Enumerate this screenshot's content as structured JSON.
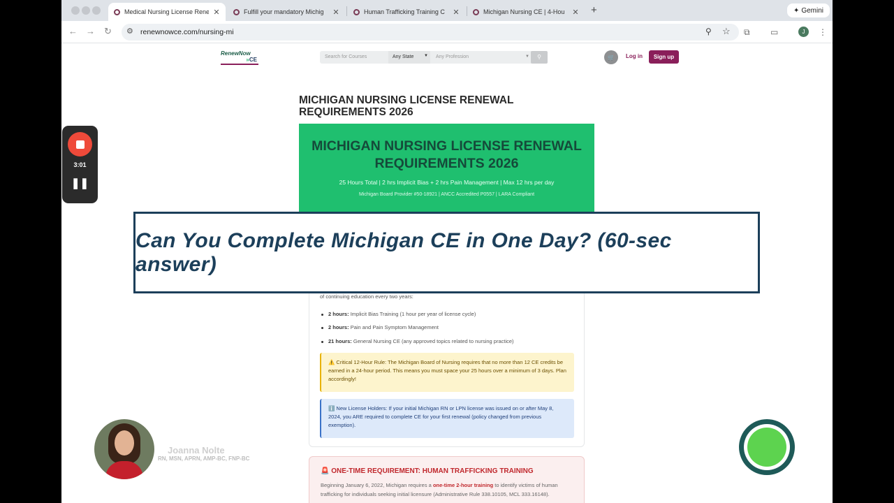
{
  "browser": {
    "tabs": [
      {
        "title": "Medical Nursing License Rene",
        "active": true
      },
      {
        "title": "Fulfill your mandatory Michig",
        "active": false
      },
      {
        "title": "Human Trafficking Training C",
        "active": false
      },
      {
        "title": "Michigan Nursing CE | 4-Hou",
        "active": false
      }
    ],
    "gemini_label": "Gemini",
    "url": "renewnowce.com/nursing-mi",
    "profile_initial": "J"
  },
  "site": {
    "logo_line1": "RenewNow",
    "logo_line2": "CE",
    "search_placeholder": "Search for Courses",
    "state_select": "Any State",
    "profession_placeholder": "Any Profession",
    "login": "Log in",
    "signup": "Sign up"
  },
  "content": {
    "heading": "MICHIGAN NURSING LICENSE RENEWAL REQUIREMENTS 2026",
    "hero_title": "MICHIGAN NURSING LICENSE RENEWAL REQUIREMENTS 2026",
    "hero_subtitle": "25 Hours Total | 2 hrs Implicit Bias + 2 hrs Pain Management | Max 12 hrs per day",
    "hero_provider": "Michigan Board Provider #50-18921 | ANCC Accredited P0557 | LARA Compliant",
    "intro": "of continuing education every two years:",
    "requirements": [
      {
        "hours": "2 hours:",
        "text": "Implicit Bias Training (1 hour per year of license cycle)"
      },
      {
        "hours": "2 hours:",
        "text": "Pain and Pain Symptom Management"
      },
      {
        "hours": "21 hours:",
        "text": "General Nursing CE (any approved topics related to nursing practice)"
      }
    ],
    "warning": "⚠️ Critical 12-Hour Rule: The Michigan Board of Nursing requires that no more than 12 CE credits be earned in a 24-hour period. This means you must space your 25 hours over a minimum of 3 days. Plan accordingly!",
    "info": "ℹ️ New License Holders: If your initial Michigan RN or LPN license was issued on or after May 8, 2024, you ARE required to complete CE for your first renewal (policy changed from previous exemption).",
    "trafficking_title": "🚨 ONE-TIME REQUIREMENT: HUMAN TRAFFICKING TRAINING",
    "trafficking_before": "Beginning January 6, 2022, Michigan requires a ",
    "trafficking_bold": "one-time 2-hour training",
    "trafficking_after": " to identify victims of human trafficking for individuals seeking initial licensure (Administrative Rule 338.10105, MCL 333.16148)."
  },
  "recorder": {
    "time": "3:01"
  },
  "overlay": {
    "banner": "Can You Complete Michigan CE in One Day? (60-sec answer)"
  },
  "presenter": {
    "name": "Joanna Nolte",
    "credentials": "RN, MSN, APRN, AMP-BC, FNP-BC"
  }
}
